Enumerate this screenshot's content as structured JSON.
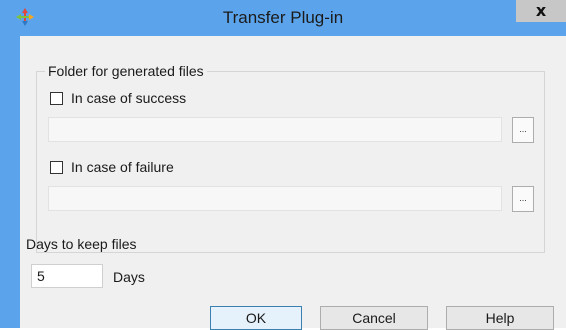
{
  "window": {
    "title": "Transfer Plug-in",
    "close_glyph": "x"
  },
  "icons": {
    "app": "transfer-plugin-icon",
    "close": "close-icon",
    "browse": "ellipsis-icon"
  },
  "group": {
    "legend": "Folder for generated files",
    "success": {
      "label": "In case of success",
      "checked": false,
      "path": "",
      "browse_label": "..."
    },
    "failure": {
      "label": "In case of failure",
      "checked": false,
      "path": "",
      "browse_label": "..."
    }
  },
  "retention": {
    "label": "Days to keep files",
    "value": "5",
    "unit": "Days"
  },
  "buttons": {
    "ok": "OK",
    "cancel": "Cancel",
    "help": "Help"
  },
  "colors": {
    "titlebar": "#5ba4ec",
    "client": "#f0f0f0",
    "close_button": "#c7c7c7"
  }
}
